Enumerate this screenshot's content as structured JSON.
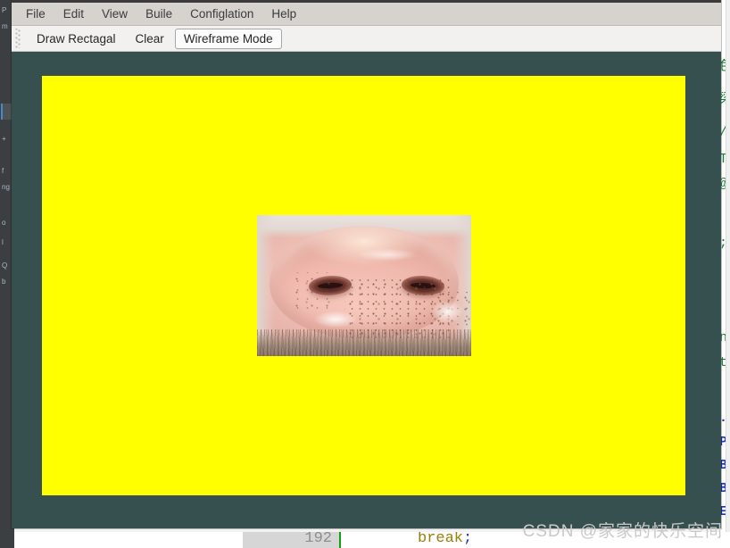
{
  "background_ide": {
    "rail_icon_labels": [
      "P",
      "m",
      "+",
      "f",
      "ng",
      "o",
      "l",
      "Q",
      "b"
    ],
    "right_code_fragments": [
      {
        "text": "色",
        "color_role": "comment"
      },
      {
        "text": "梁",
        "color_role": "comment"
      },
      {
        "text": "/",
        "color_role": "comment"
      },
      {
        "text": "T",
        "color_role": "comment"
      },
      {
        "text": "@",
        "color_role": "comment"
      },
      {
        "text": ";",
        "color_role": "comment"
      },
      {
        "text": "n",
        "color_role": "comment"
      },
      {
        "text": "t",
        "color_role": "comment"
      },
      {
        "text": ".",
        "color_role": "keyword"
      },
      {
        "text": "P",
        "color_role": "keyword"
      },
      {
        "text": "B",
        "color_role": "keyword"
      },
      {
        "text": "B",
        "color_role": "keyword"
      },
      {
        "text": "E",
        "color_role": "keyword"
      }
    ],
    "bottom_line_number": "192",
    "bottom_code_text": "break",
    "bottom_code_semicolon": ";"
  },
  "app": {
    "menubar": [
      {
        "label": "File"
      },
      {
        "label": "Edit"
      },
      {
        "label": "View"
      },
      {
        "label": "Buile"
      },
      {
        "label": "Configlation"
      },
      {
        "label": "Help"
      }
    ],
    "toolbar": [
      {
        "label": "Draw Rectagal",
        "active": false
      },
      {
        "label": "Clear",
        "active": false
      },
      {
        "label": "Wireframe Mode",
        "active": true
      }
    ],
    "canvas": {
      "background_color": "#35504e",
      "sheet_color": "#ffff00",
      "image_name": "pig-snout-photo"
    }
  },
  "watermark": {
    "text": "CSDN @家家的快乐空间"
  },
  "colors": {
    "app_canvas_teal": "#35504e",
    "sheet_yellow": "#ffff00",
    "menubar_gray": "#d6d2cd",
    "toolbar_gray": "#f2f1ef",
    "ide_rail_dark": "#3c3f41",
    "code_comment_green": "#1a7f37",
    "code_keyword_blue": "#1d35c8",
    "code_string_gold": "#9b7d0a"
  }
}
